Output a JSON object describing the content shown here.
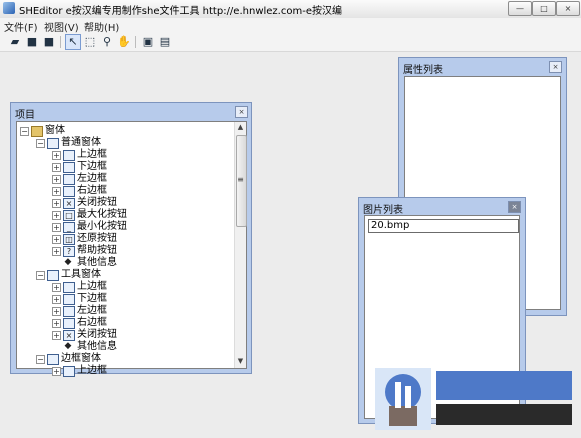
{
  "title_bar": {
    "title": "SHEditor  e按汉编专用制作she文件工具  http://e.hnwlez.com-e按汉编",
    "min": "—",
    "max": "□",
    "close": "×"
  },
  "menu": [
    "文件(F)",
    "视图(V)",
    "帮助(H)"
  ],
  "toolbar": {
    "buttons": [
      "open-icon",
      "save-icon",
      "save-all-icon",
      "pointer-icon",
      "select-rect-icon",
      "zoom-icon",
      "hand-icon",
      "view-icon",
      "settings-icon"
    ],
    "glyphs": [
      "▰",
      "■",
      "■",
      "↖",
      "⬚",
      "⚲",
      "✋",
      "▣",
      "▤"
    ]
  },
  "project_panel": {
    "title": "项目",
    "close": "×",
    "tree": [
      {
        "label": "窗体",
        "depth": 0,
        "exp": "−",
        "icon": "folder",
        "glyph": ""
      },
      {
        "label": "普通窗体",
        "depth": 1,
        "exp": "−",
        "icon": "box",
        "glyph": ""
      },
      {
        "label": "上边框",
        "depth": 2,
        "exp": "+",
        "icon": "box",
        "glyph": ""
      },
      {
        "label": "下边框",
        "depth": 2,
        "exp": "+",
        "icon": "box",
        "glyph": ""
      },
      {
        "label": "左边框",
        "depth": 2,
        "exp": "+",
        "icon": "box",
        "glyph": ""
      },
      {
        "label": "右边框",
        "depth": 2,
        "exp": "+",
        "icon": "box",
        "glyph": ""
      },
      {
        "label": "关闭按钮",
        "depth": 2,
        "exp": "+",
        "icon": "box",
        "glyph": "×"
      },
      {
        "label": "最大化按钮",
        "depth": 2,
        "exp": "+",
        "icon": "box",
        "glyph": "□"
      },
      {
        "label": "最小化按钮",
        "depth": 2,
        "exp": "+",
        "icon": "box",
        "glyph": "_"
      },
      {
        "label": "还原按钮",
        "depth": 2,
        "exp": "+",
        "icon": "box",
        "glyph": "◫"
      },
      {
        "label": "帮助按钮",
        "depth": 2,
        "exp": "+",
        "icon": "box",
        "glyph": "?"
      },
      {
        "label": "其他信息",
        "depth": 2,
        "exp": "",
        "icon": "diamond",
        "glyph": "◆"
      },
      {
        "label": "工具窗体",
        "depth": 1,
        "exp": "−",
        "icon": "box",
        "glyph": ""
      },
      {
        "label": "上边框",
        "depth": 2,
        "exp": "+",
        "icon": "box",
        "glyph": ""
      },
      {
        "label": "下边框",
        "depth": 2,
        "exp": "+",
        "icon": "box",
        "glyph": ""
      },
      {
        "label": "左边框",
        "depth": 2,
        "exp": "+",
        "icon": "box",
        "glyph": ""
      },
      {
        "label": "右边框",
        "depth": 2,
        "exp": "+",
        "icon": "box",
        "glyph": ""
      },
      {
        "label": "关闭按钮",
        "depth": 2,
        "exp": "+",
        "icon": "box",
        "glyph": "×"
      },
      {
        "label": "其他信息",
        "depth": 2,
        "exp": "",
        "icon": "diamond",
        "glyph": "◆"
      },
      {
        "label": "边框窗体",
        "depth": 1,
        "exp": "−",
        "icon": "box",
        "glyph": ""
      },
      {
        "label": "上边框",
        "depth": 2,
        "exp": "+",
        "icon": "box",
        "glyph": ""
      }
    ]
  },
  "properties_panel": {
    "title": "属性列表",
    "close": "×"
  },
  "images_panel": {
    "title": "图片列表",
    "close": "×",
    "items": [
      "20.bmp"
    ]
  },
  "scroll": {
    "up": "▲",
    "down": "▼",
    "grip": "≡"
  }
}
